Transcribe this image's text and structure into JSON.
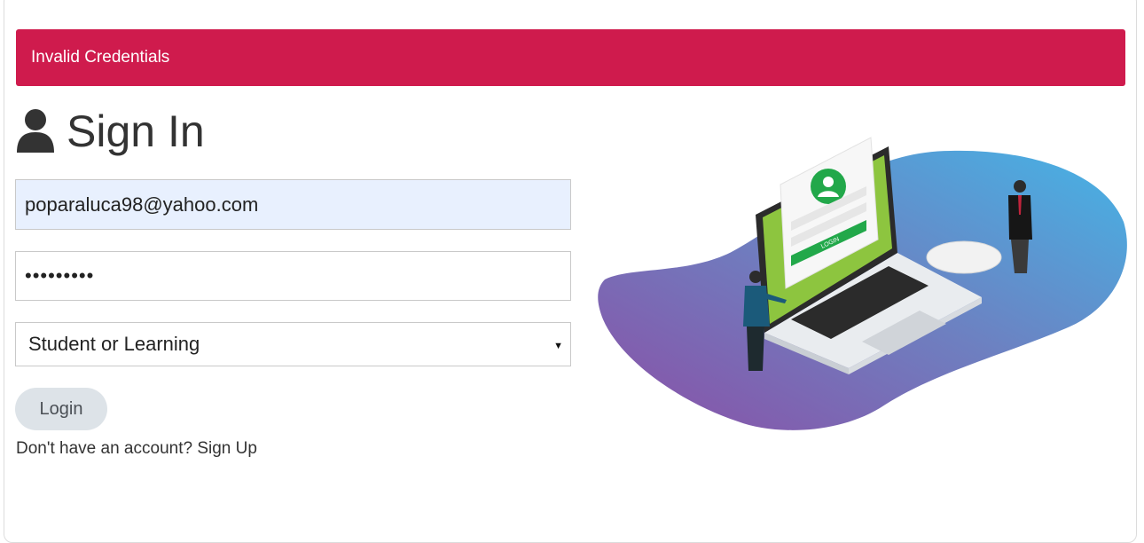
{
  "alert": {
    "message": "Invalid Credentials",
    "color": "#cf1b4d"
  },
  "heading": {
    "title": "Sign In",
    "icon": "user-icon"
  },
  "form": {
    "email_value": "poparaluca98@yahoo.com",
    "password_mask": "•••••••••",
    "role_selected": "Student or Learning",
    "login_label": "Login"
  },
  "signup": {
    "prompt": "Don't have an account?",
    "link_label": "Sign Up"
  },
  "illustration": {
    "button_text": "LOGIN"
  }
}
